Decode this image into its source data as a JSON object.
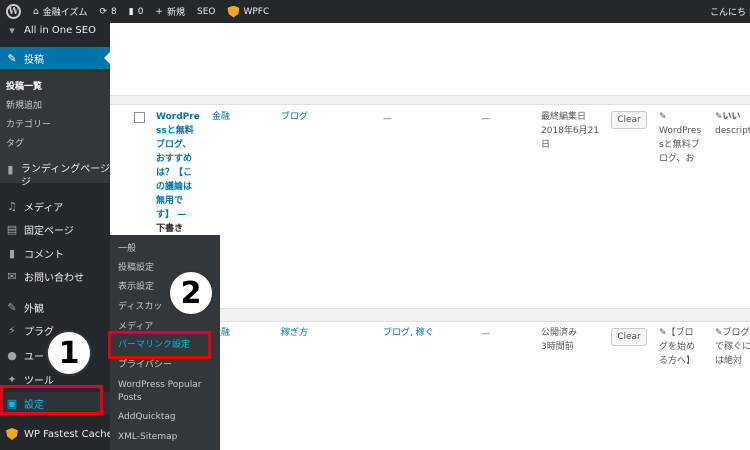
{
  "adminbar": {
    "site_name": "金融イズム",
    "updates_count": "8",
    "comments_count": "0",
    "new_label": "新規",
    "seo_label": "SEO",
    "wpfc_label": "WPFC",
    "greeting": "こんにち"
  },
  "sidebar": {
    "top_item": "All in One SEO",
    "posts": "投稿",
    "sub": [
      "投稿一覧",
      "新規追加",
      "カテゴリー",
      "タグ"
    ],
    "landing": "ランディングページ",
    "landing_line2": "ジ",
    "media": "メディア",
    "pages": "固定ページ",
    "comments": "コメント",
    "contact": "お問い合わせ",
    "appearance": "外観",
    "plugins": "プラグ",
    "users": "ユー",
    "tools": "ツール",
    "settings": "設定",
    "wpfc": "WP Fastest Cache"
  },
  "flyout": {
    "items": [
      "一般",
      "投稿設定",
      "表示設定",
      "ディスカッ",
      "メディア",
      "パーマリンク設定",
      "プライバシー",
      "WordPress Popular Posts",
      "AddQuicktag",
      "XML-Sitemap"
    ]
  },
  "rows": {
    "r1": {
      "title": [
        "WordPre",
        "ssと無料",
        "ブログ、",
        "おすすめ",
        "は？【こ",
        "の議論は",
        "無用で",
        "す】 —",
        "下書き"
      ],
      "category": "金融",
      "tags": "ブログ",
      "dash1": "—",
      "dash2": "—",
      "date": [
        "最終編集日",
        "2018年6月21",
        "日"
      ],
      "clear": "Clear",
      "seo": [
        "WordPres",
        "sと無料ブ",
        "ログ、お"
      ],
      "desc": [
        "いい",
        "descripti"
      ]
    },
    "r2": {
      "category": "金融",
      "tags": "稼ぎ方",
      "tags2": "ブログ, 稼ぐ",
      "dash": "—",
      "date": [
        "公開済み",
        "3時間前"
      ],
      "clear": "Clear",
      "seo": [
        "【ブロ",
        "グを始め",
        "る方へ】"
      ],
      "desc": [
        "ブログ",
        "で稼ぐに",
        "は絶対"
      ]
    }
  },
  "annotations": {
    "one": "1",
    "two": "2"
  },
  "colors": {
    "accent": "#0073aa",
    "highlight": "#e60012",
    "flyout_highlight": "#00b9eb"
  }
}
